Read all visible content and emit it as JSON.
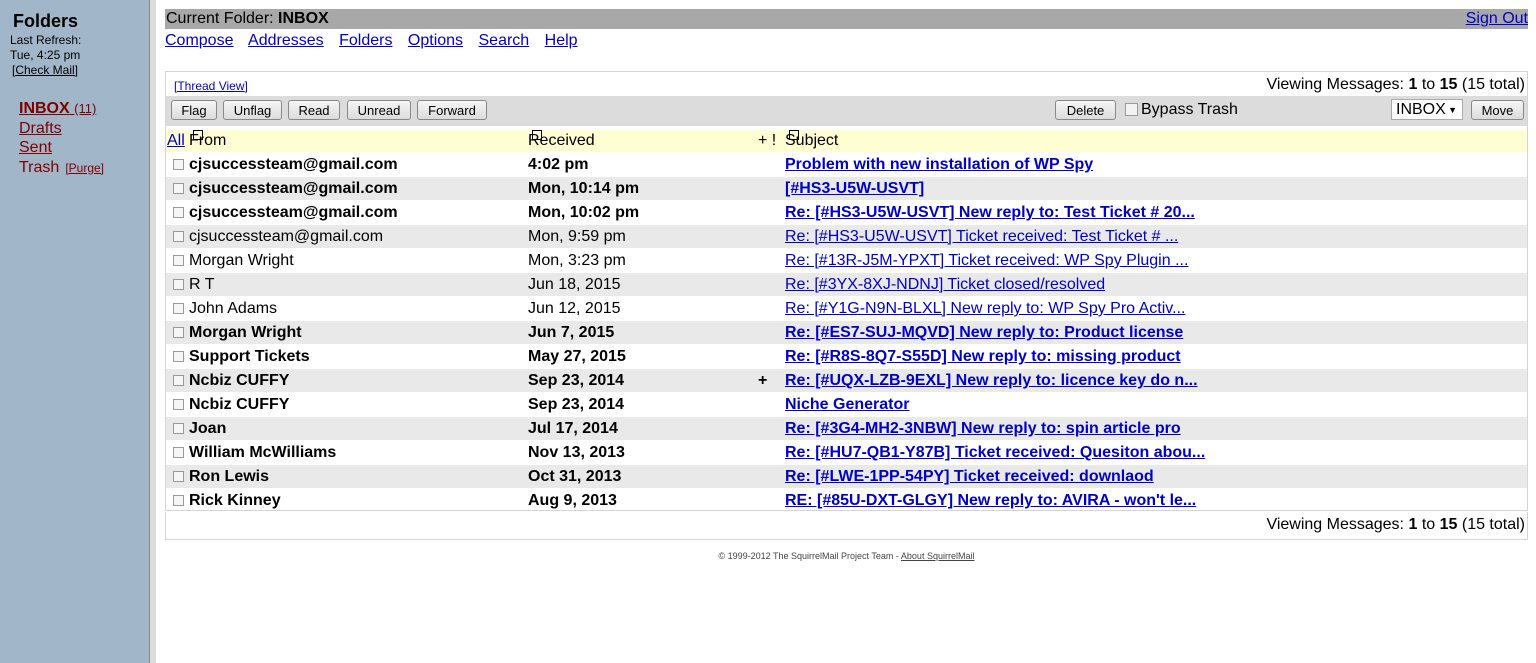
{
  "sidebar": {
    "title": "Folders",
    "last_refresh_label": "Last Refresh:",
    "last_refresh_time": "Tue, 4:25 pm",
    "check_mail": "[Check Mail]",
    "folders": [
      {
        "name": "INBOX",
        "count": "(11)"
      },
      {
        "name": "Drafts"
      },
      {
        "name": "Sent"
      },
      {
        "name": "Trash",
        "purge": "[Purge]"
      }
    ]
  },
  "titlebar": {
    "current_folder_label": "Current Folder:",
    "current_folder": "INBOX",
    "sign_out": "Sign Out"
  },
  "menu": [
    "Compose",
    "Addresses",
    "Folders",
    "Options",
    "Search",
    "Help"
  ],
  "messages": {
    "thread_view": "[Thread View]",
    "viewing": {
      "prefix": "Viewing Messages:",
      "from": "1",
      "to_word": "to",
      "to": "15",
      "total": "(15 total)"
    },
    "buttons": {
      "flag": "Flag",
      "unflag": "Unflag",
      "read": "Read",
      "unread": "Unread",
      "forward": "Forward",
      "delete": "Delete",
      "move": "Move"
    },
    "bypass_trash": "Bypass Trash",
    "move_target": "INBOX",
    "columns": {
      "all": "All",
      "from": "From",
      "received": "Received",
      "flags": "+ !",
      "subject": "Subject"
    },
    "rows": [
      {
        "from": "cjsuccessteam@gmail.com",
        "received": "4:02 pm",
        "flag": "",
        "subject": "Problem with new installation of WP Spy",
        "unread": true
      },
      {
        "from": "cjsuccessteam@gmail.com",
        "received": "Mon, 10:14 pm",
        "flag": "",
        "subject": "[#HS3-U5W-USVT]",
        "unread": true
      },
      {
        "from": "cjsuccessteam@gmail.com",
        "received": "Mon, 10:02 pm",
        "flag": "",
        "subject": "Re: [#HS3-U5W-USVT] New reply to: Test Ticket # 20...",
        "unread": true
      },
      {
        "from": "cjsuccessteam@gmail.com",
        "received": "Mon, 9:59 pm",
        "flag": "",
        "subject": "Re: [#HS3-U5W-USVT] Ticket received: Test Ticket # ...",
        "unread": false
      },
      {
        "from": "Morgan Wright",
        "received": "Mon, 3:23 pm",
        "flag": "",
        "subject": "Re: [#13R-J5M-YPXT] Ticket received: WP Spy Plugin ...",
        "unread": false
      },
      {
        "from": "R T",
        "received": "Jun 18, 2015",
        "flag": "",
        "subject": "Re: [#3YX-8XJ-NDNJ] Ticket closed/resolved",
        "unread": false
      },
      {
        "from": "John Adams",
        "received": "Jun 12, 2015",
        "flag": "",
        "subject": "Re: [#Y1G-N9N-BLXL] New reply to: WP Spy Pro Activ...",
        "unread": false
      },
      {
        "from": "Morgan Wright",
        "received": "Jun 7, 2015",
        "flag": "",
        "subject": "Re: [#ES7-SUJ-MQVD] New reply to: Product license",
        "unread": true
      },
      {
        "from": "Support Tickets",
        "received": "May 27, 2015",
        "flag": "",
        "subject": "Re: [#R8S-8Q7-S55D] New reply to: missing product",
        "unread": true
      },
      {
        "from": "Ncbiz CUFFY",
        "received": "Sep 23, 2014",
        "flag": "+",
        "subject": "Re: [#UQX-LZB-9EXL] New reply to: licence key do n...",
        "unread": true
      },
      {
        "from": "Ncbiz CUFFY",
        "received": "Sep 23, 2014",
        "flag": "",
        "subject": "Niche Generator",
        "unread": true
      },
      {
        "from": "Joan",
        "received": "Jul 17, 2014",
        "flag": "",
        "subject": "Re: [#3G4-MH2-3NBW] New reply to: spin article pro",
        "unread": true
      },
      {
        "from": "William McWilliams",
        "received": "Nov 13, 2013",
        "flag": "",
        "subject": "Re: [#HU7-QB1-Y87B] Ticket received: Quesiton abou...",
        "unread": true
      },
      {
        "from": "Ron Lewis",
        "received": "Oct 31, 2013",
        "flag": "",
        "subject": "Re: [#LWE-1PP-54PY] Ticket received: downlaod",
        "unread": true
      },
      {
        "from": "Rick Kinney",
        "received": "Aug 9, 2013",
        "flag": "",
        "subject": "RE: [#85U-DXT-GLGY] New reply to: AVIRA - won't le...",
        "unread": true
      }
    ]
  },
  "footer": {
    "copyright": "© 1999-2012 The SquirrelMail Project Team -",
    "about": "About SquirrelMail"
  }
}
